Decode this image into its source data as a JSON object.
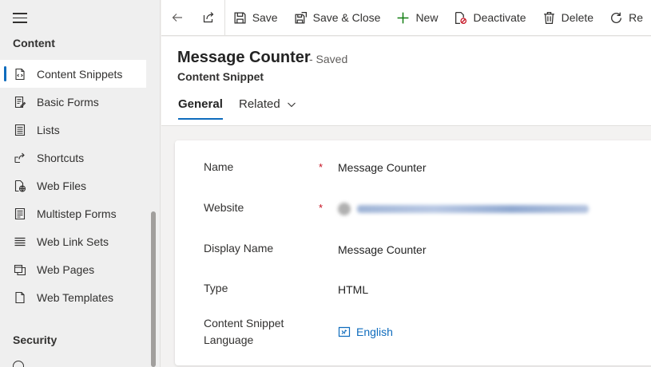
{
  "sidebar": {
    "section_content": "Content",
    "section_security": "Security",
    "items": [
      {
        "label": "Content Snippets",
        "icon": "content-snippet-icon",
        "active": true
      },
      {
        "label": "Basic Forms",
        "icon": "basic-form-icon"
      },
      {
        "label": "Lists",
        "icon": "list-icon"
      },
      {
        "label": "Shortcuts",
        "icon": "shortcut-icon"
      },
      {
        "label": "Web Files",
        "icon": "web-file-icon"
      },
      {
        "label": "Multistep Forms",
        "icon": "multistep-form-icon"
      },
      {
        "label": "Web Link Sets",
        "icon": "link-set-icon"
      },
      {
        "label": "Web Pages",
        "icon": "web-page-icon"
      },
      {
        "label": "Web Templates",
        "icon": "web-template-icon"
      }
    ]
  },
  "toolbar": {
    "save": "Save",
    "save_close": "Save & Close",
    "new": "New",
    "deactivate": "Deactivate",
    "delete": "Delete",
    "refresh": "Re"
  },
  "record": {
    "title": "Message Counter",
    "status": "- Saved",
    "entity": "Content Snippet"
  },
  "tabs": {
    "general": "General",
    "related": "Related"
  },
  "form": {
    "name_label": "Name",
    "name_value": "Message Counter",
    "website_label": "Website",
    "display_name_label": "Display Name",
    "display_name_value": "Message Counter",
    "type_label": "Type",
    "type_value": "HTML",
    "language_label_line1": "Content Snippet",
    "language_label_line2": "Language",
    "language_value": "English",
    "required_mark": "*"
  },
  "colors": {
    "accent": "#0f6cbd",
    "required": "#c50f1f",
    "sidebar_bg": "#efefef"
  }
}
